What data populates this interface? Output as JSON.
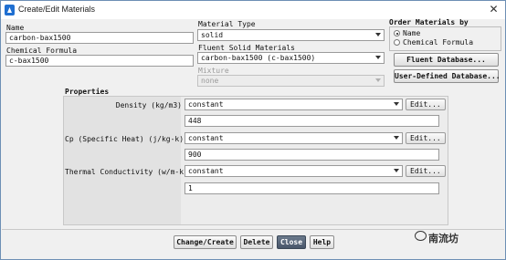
{
  "window": {
    "title": "Create/Edit Materials"
  },
  "name_field": {
    "label": "Name",
    "value": "carbon-bax1500"
  },
  "chemical_formula_field": {
    "label": "Chemical Formula",
    "value": "c-bax1500"
  },
  "material_type": {
    "label": "Material Type",
    "value": "solid"
  },
  "fluent_solid_materials": {
    "label": "Fluent Solid Materials",
    "value": "carbon-bax1500 (c-bax1500)"
  },
  "mixture": {
    "label": "Mixture",
    "value": "none"
  },
  "order": {
    "label": "Order Materials by",
    "options": [
      {
        "label": "Name",
        "selected": true
      },
      {
        "label": "Chemical Formula",
        "selected": false
      }
    ]
  },
  "side_buttons": {
    "fluent_database": "Fluent Database...",
    "user_defined_database": "User-Defined Database..."
  },
  "properties": {
    "label": "Properties",
    "rows": [
      {
        "label": "Density (kg/m3)",
        "method": "constant",
        "edit": "Edit...",
        "value": "448"
      },
      {
        "label": "Cp (Specific Heat) (j/kg-k)",
        "method": "constant",
        "edit": "Edit...",
        "value": "900"
      },
      {
        "label": "Thermal Conductivity (w/m-k)",
        "method": "constant",
        "edit": "Edit...",
        "value": "1"
      }
    ]
  },
  "bottom_buttons": {
    "change_create": "Change/Create",
    "delete": "Delete",
    "close": "Close",
    "help": "Help"
  },
  "watermark": "南流坊"
}
